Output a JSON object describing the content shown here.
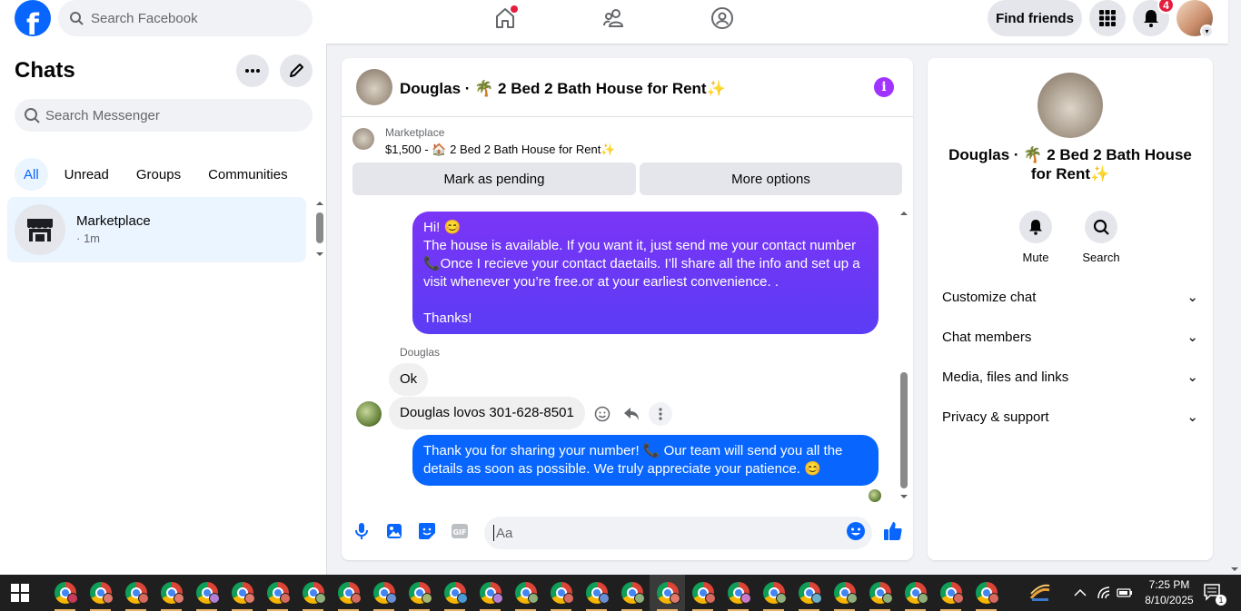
{
  "topbar": {
    "logo_letter": "f",
    "search_placeholder": "Search Facebook",
    "find_friends_label": "Find friends",
    "notifications_count": "4"
  },
  "left": {
    "title": "Chats",
    "search_placeholder": "Search Messenger",
    "filters": [
      "All",
      "Unread",
      "Groups",
      "Communities"
    ],
    "chat": {
      "name": "Marketplace",
      "time": "· 1m"
    }
  },
  "conversation": {
    "title": "Douglas · 🌴 2 Bed 2 Bath House for Rent✨",
    "marketplace": {
      "label": "Marketplace",
      "listing": "$1,500 - 🏠 2 Bed 2 Bath House for Rent✨",
      "mark_pending_label": "Mark as pending",
      "more_options_label": "More options"
    },
    "messages": {
      "out1_line1": "Hi! 😊",
      "out1_line2": "The house is available. If you want it, just send me your contact number 📞Once I recieve your contact daetails. I’ll share all the info and set up a visit whenever you’re free.or at your earliest convenience. .",
      "out1_line3": "Thanks!",
      "sender_name": "Douglas",
      "in1": "Ok",
      "in2": "Douglas lovos 301-628-8501",
      "out2": "Thank you for sharing your number! 📞 Our team will send you all the details as soon as possible. We truly appreciate your patience. 😊"
    },
    "composer_placeholder": "Aa"
  },
  "right": {
    "name": "Douglas · 🌴 2 Bed 2 Bath House for Rent✨",
    "actions": [
      "Mute",
      "Search"
    ],
    "rows": [
      "Customize chat",
      "Chat members",
      "Media, files and links",
      "Privacy & support"
    ]
  },
  "taskbar": {
    "time": "7:25 PM",
    "date": "8/10/2025",
    "notification_count": "1"
  },
  "colors": {
    "accent": "#0866ff",
    "outgoing_gradient_top": "#7b35f6",
    "outgoing_gradient_bottom": "#5b3cf5",
    "badge": "#e41e3f"
  }
}
